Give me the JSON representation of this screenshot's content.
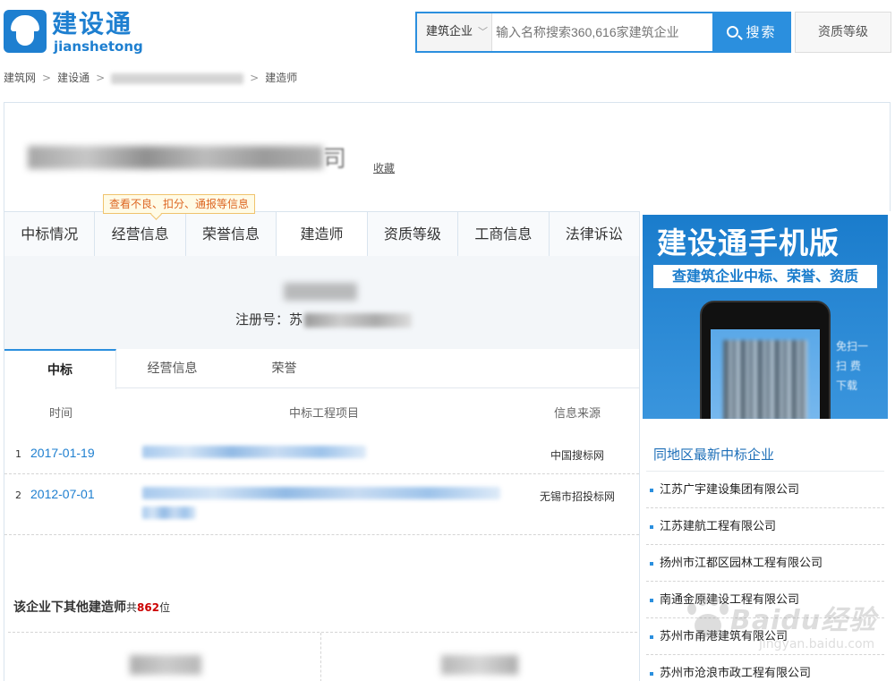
{
  "header": {
    "logo_cn": "建设通",
    "logo_en": "jianshetong",
    "search_type": "建筑企业",
    "search_placeholder": "输入名称搜索360,616家建筑企业",
    "search_button": "搜索",
    "qualification_button": "资质等级"
  },
  "breadcrumb": {
    "items": [
      "建筑网",
      "建设通",
      "建造师"
    ]
  },
  "company": {
    "name_suffix": "司",
    "favorite": "收藏"
  },
  "tooltip": "查看不良、扣分、通报等信息",
  "main_tabs": [
    "中标情况",
    "经营信息",
    "荣誉信息",
    "建造师",
    "资质等级",
    "工商信息",
    "法律诉讼"
  ],
  "engineer": {
    "reg_label": "注册号：苏"
  },
  "sub_tabs": [
    "中标",
    "经营信息",
    "荣誉"
  ],
  "table": {
    "headers": {
      "time": "时间",
      "project": "中标工程项目",
      "source": "信息来源"
    },
    "rows": [
      {
        "num": "1",
        "date": "2017-01-19",
        "source": "中国搜标网"
      },
      {
        "num": "2",
        "date": "2012-07-01",
        "source": "无锡市招投标网"
      }
    ]
  },
  "others": {
    "label": "该企业下其他建造师",
    "prefix": "共",
    "count": "862",
    "suffix": "位"
  },
  "ad": {
    "title": "建设通手机版",
    "subtitle": "查建筑企业中标、荣誉、资质",
    "side_text": "免扫一扫 费 下载"
  },
  "nearby": {
    "title": "同地区最新中标企业",
    "items": [
      "江苏广宇建设集团有限公司",
      "江苏建航工程有限公司",
      "扬州市江都区园林工程有限公司",
      "南通金原建设工程有限公司",
      "苏州市甬港建筑有限公司",
      "苏州市沧浪市政工程有限公司"
    ]
  },
  "watermark": {
    "text": "Baidu经验",
    "url": "jingyan.baidu.com"
  },
  "colors": {
    "brand": "#1e7fd0",
    "accent": "#2b8fde",
    "count": "#cc0000",
    "tooltip_text": "#dd6622"
  }
}
